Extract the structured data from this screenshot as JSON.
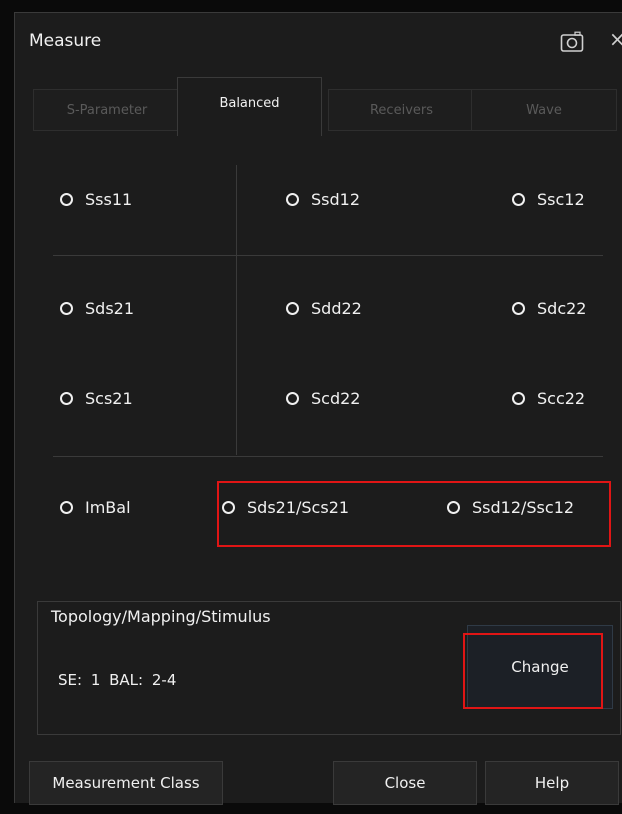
{
  "dialog": {
    "title": "Measure",
    "close_glyph": "×",
    "icons": [
      "camera-icon",
      "close-icon"
    ]
  },
  "tabs": [
    {
      "label": "S-Parameter",
      "active": false
    },
    {
      "label": "Balanced",
      "active": true
    },
    {
      "label": "Receivers",
      "active": false
    },
    {
      "label": "Wave",
      "active": false
    }
  ],
  "measurements": {
    "row1": [
      "Sss11",
      "Ssd12",
      "Ssc12"
    ],
    "row2": [
      "Sds21",
      "Sdd22",
      "Sdc22"
    ],
    "row3": [
      "Scs21",
      "Scd22",
      "Scc22"
    ],
    "row4": [
      "ImBal",
      "Sds21/Scs21",
      "Ssd12/Ssc12"
    ]
  },
  "topology": {
    "legend": "Topology/Mapping/Stimulus",
    "value": "SE: 1   BAL: 2-4",
    "change_label": "Change"
  },
  "buttons": {
    "measurement_class": "Measurement Class",
    "close": "Close",
    "help": "Help"
  },
  "colors": {
    "highlight": "#e01515",
    "background": "#1c1c1c"
  }
}
